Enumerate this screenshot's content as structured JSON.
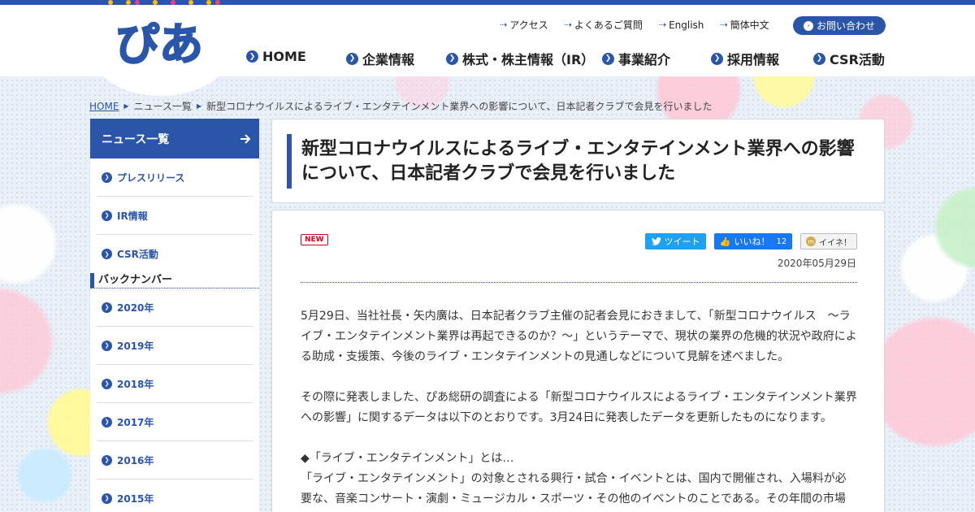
{
  "logo": {
    "text": "ぴあ"
  },
  "utility_nav": [
    {
      "label": "アクセス"
    },
    {
      "label": "よくあるご質問"
    },
    {
      "label": "English"
    },
    {
      "label": "簡体中文"
    }
  ],
  "contact_label": "お問い合わせ",
  "global_nav": [
    {
      "label": "HOME"
    },
    {
      "label": "企業情報"
    },
    {
      "label": "株式・株主情報（IR）"
    },
    {
      "label": "事業紹介"
    },
    {
      "label": "採用情報"
    },
    {
      "label": "CSR活動"
    }
  ],
  "breadcrumb": {
    "home": "HOME",
    "news": "ニュース一覧",
    "current": "新型コロナウイルスによるライブ・エンタテインメント業界への影響について、日本記者クラブで会見を行いました"
  },
  "sidebar": {
    "heading": "ニュース一覧",
    "categories": [
      {
        "label": "プレスリリース"
      },
      {
        "label": "IR情報"
      },
      {
        "label": "CSR活動"
      }
    ],
    "backnumber_heading": "バックナンバー",
    "years": [
      {
        "label": "2020年"
      },
      {
        "label": "2019年"
      },
      {
        "label": "2018年"
      },
      {
        "label": "2017年"
      },
      {
        "label": "2016年"
      },
      {
        "label": "2015年"
      }
    ]
  },
  "article": {
    "title": "新型コロナウイルスによるライブ・エンタテインメント業界への影響について、日本記者クラブで会見を行いました",
    "badge": "NEW",
    "share": {
      "tweet": "ツイート",
      "like": "いいね！",
      "like_count": "12",
      "iine": "イイネ！"
    },
    "date": "2020年05月29日",
    "paragraphs": [
      "5月29日、当社社長・矢内廣は、日本記者クラブ主催の記者会見におきまして、「新型コロナウイルス　～ライブ・エンタテインメント業界は再起できるのか？～」というテーマで、現状の業界の危機的状況や政府による助成・支援策、今後のライブ・エンタテインメントの見通しなどについて見解を述べました。",
      "その際に発表しました、ぴあ総研の調査による「新型コロナウイルスによるライブ・エンタテインメント業界への影響」に関するデータは以下のとおりです。3月24日に発表したデータを更新したものになります。",
      "◆「ライブ・エンタテインメント」とは…",
      "「ライブ・エンタテインメント」の対象とされる興行・試合・イベントとは、国内で開催され、入場料が必要な、音楽コンサート・演劇・ミュージカル・スポーツ・その他のイベントのことである。その年間の市場"
    ]
  },
  "colors": {
    "brand": "#2a55a8",
    "new_badge": "#d0021b",
    "twitter": "#1da1f2",
    "facebook": "#1877f2"
  }
}
